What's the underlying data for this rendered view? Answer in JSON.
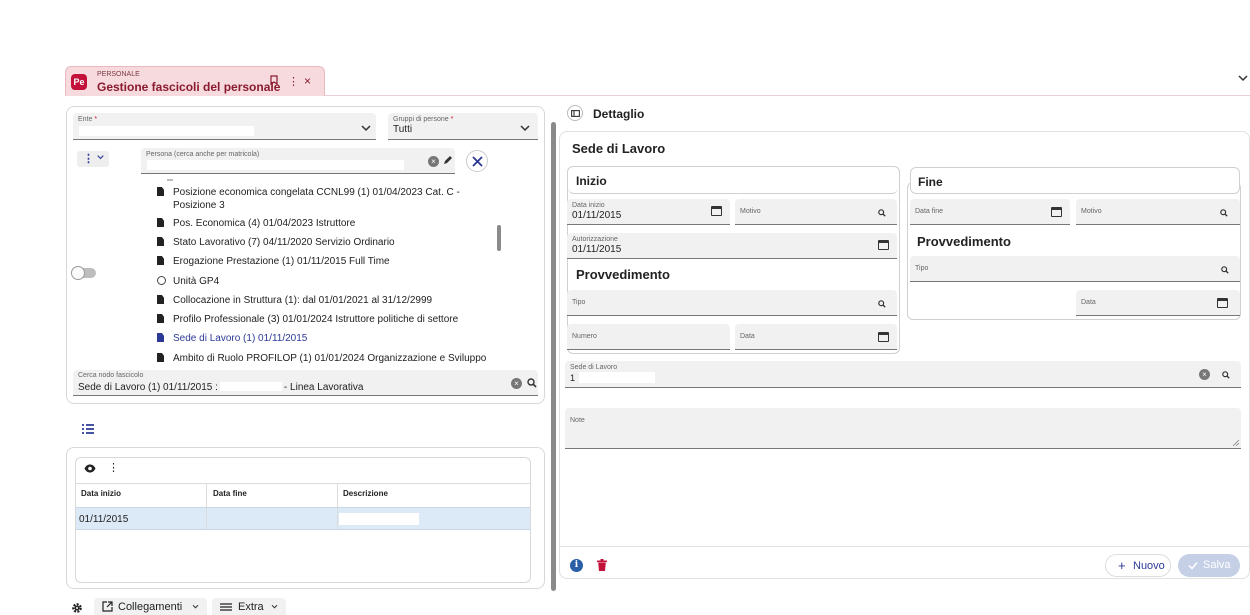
{
  "tab": {
    "logo": "Pe",
    "module": "PERSONALE",
    "title": "Gestione fascicoli del personale"
  },
  "left": {
    "ente_label": "Ente",
    "ente_req": "*",
    "gruppi_label": "Gruppi di persone",
    "gruppi_req": "*",
    "gruppi_value": "Tutti",
    "persona_label": "Persona (cerca anche per matricola)",
    "tree": [
      "Posizione economica congelata CCNL99 (1) 01/04/2023  Cat. C -",
      "Posizione 3",
      "Pos. Economica (4) 01/04/2023  Istruttore",
      "Stato Lavorativo (7) 04/11/2020  Servizio Ordinario",
      "Erogazione Prestazione (1) 01/11/2015  Full Time",
      "Unità GP4",
      "Collocazione in Struttura (1): dal 01/01/2021 al 31/12/2999",
      "Profilo Professionale (3) 01/01/2024  Istruttore politiche di settore",
      "Sede di Lavoro (1) 01/11/2015",
      "Ambito di Ruolo PROFILOP (1) 01/01/2024  Organizzazione e Sviluppo"
    ],
    "cerca_label": "Cerca nodo fascicolo",
    "cerca_value_a": "Sede di Lavoro (1) 01/11/2015 :",
    "cerca_value_b": "- Linea Lavorativa"
  },
  "grid": {
    "columns": [
      "Data inizio",
      "Data fine",
      "Descrizione"
    ],
    "rows": [
      [
        "01/11/2015",
        "",
        ""
      ]
    ]
  },
  "detail": {
    "header": "Dettaglio",
    "title": "Sede di Lavoro",
    "inizio": {
      "title": "Inizio",
      "data_inizio_label": "Data inizio",
      "data_inizio_value": "01/11/2015",
      "motivo_label": "Motivo",
      "autorizzazione_label": "Autorizzazione",
      "autorizzazione_value": "01/11/2015"
    },
    "provv1": {
      "title": "Provvedimento",
      "tipo_label": "Tipo",
      "numero_label": "Numero",
      "data_label": "Data"
    },
    "fine": {
      "title": "Fine",
      "data_fine_label": "Data fine",
      "motivo_label": "Motivo"
    },
    "provv2": {
      "title": "Provvedimento",
      "tipo_label": "Tipo",
      "data_label": "Data"
    },
    "sede_label": "Sede di Lavoro",
    "sede_value": "1",
    "note_label": "Note",
    "nuovo": "Nuovo",
    "salva": "Salva"
  },
  "bottombar": {
    "collegamenti": "Collegamenti",
    "extra": "Extra"
  },
  "colors": {
    "accent": "#c2123a",
    "primary": "#2c3a96",
    "info": "#2a5fa6"
  }
}
